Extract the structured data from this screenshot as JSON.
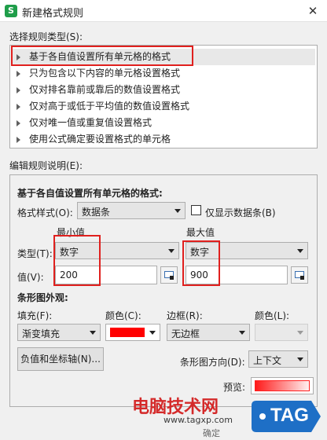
{
  "window": {
    "title": "新建格式规则",
    "app_icon_letter": "S",
    "close_glyph": "✕"
  },
  "rule_types": {
    "label": "选择规则类型(S):",
    "items": [
      {
        "label": "基于各自值设置所有单元格的格式",
        "selected": true
      },
      {
        "label": "只为包含以下内容的单元格设置格式"
      },
      {
        "label": "仅对排名靠前或靠后的数值设置格式"
      },
      {
        "label": "仅对高于或低于平均值的数值设置格式"
      },
      {
        "label": "仅对唯一值或重复值设置格式"
      },
      {
        "label": "使用公式确定要设置格式的单元格"
      }
    ]
  },
  "rule_desc": {
    "label": "编辑规则说明(E):",
    "heading": "基于各自值设置所有单元格的格式:",
    "format_style_label": "格式样式(O):",
    "format_style_value": "数据条",
    "show_bar_only_label": "仅显示数据条(B)",
    "min_header": "最小值",
    "max_header": "最大值",
    "type_label": "类型(T):",
    "min_type": "数字",
    "max_type": "数字",
    "value_label": "值(V):",
    "min_value": "200",
    "max_value": "900",
    "bar_appearance_heading": "条形图外观:",
    "fill_label": "填充(F):",
    "fill_value": "渐变填充",
    "color_label": "颜色(C):",
    "fill_color": "#ff0000",
    "border_label": "边框(R):",
    "border_value": "无边框",
    "border_color_label": "颜色(L):",
    "neg_axis_button": "负值和坐标轴(N)...",
    "bar_direction_label": "条形图方向(D):",
    "bar_direction_value": "上下文",
    "preview_label": "预览:"
  },
  "watermark": {
    "site_text": "电脑技术网",
    "url_text": "www.tagxp.com",
    "badge_text": "TAG",
    "bottom_text": "确定"
  },
  "colors": {
    "highlight_red": "#e0201e",
    "badge_blue": "#1e6fc6"
  }
}
